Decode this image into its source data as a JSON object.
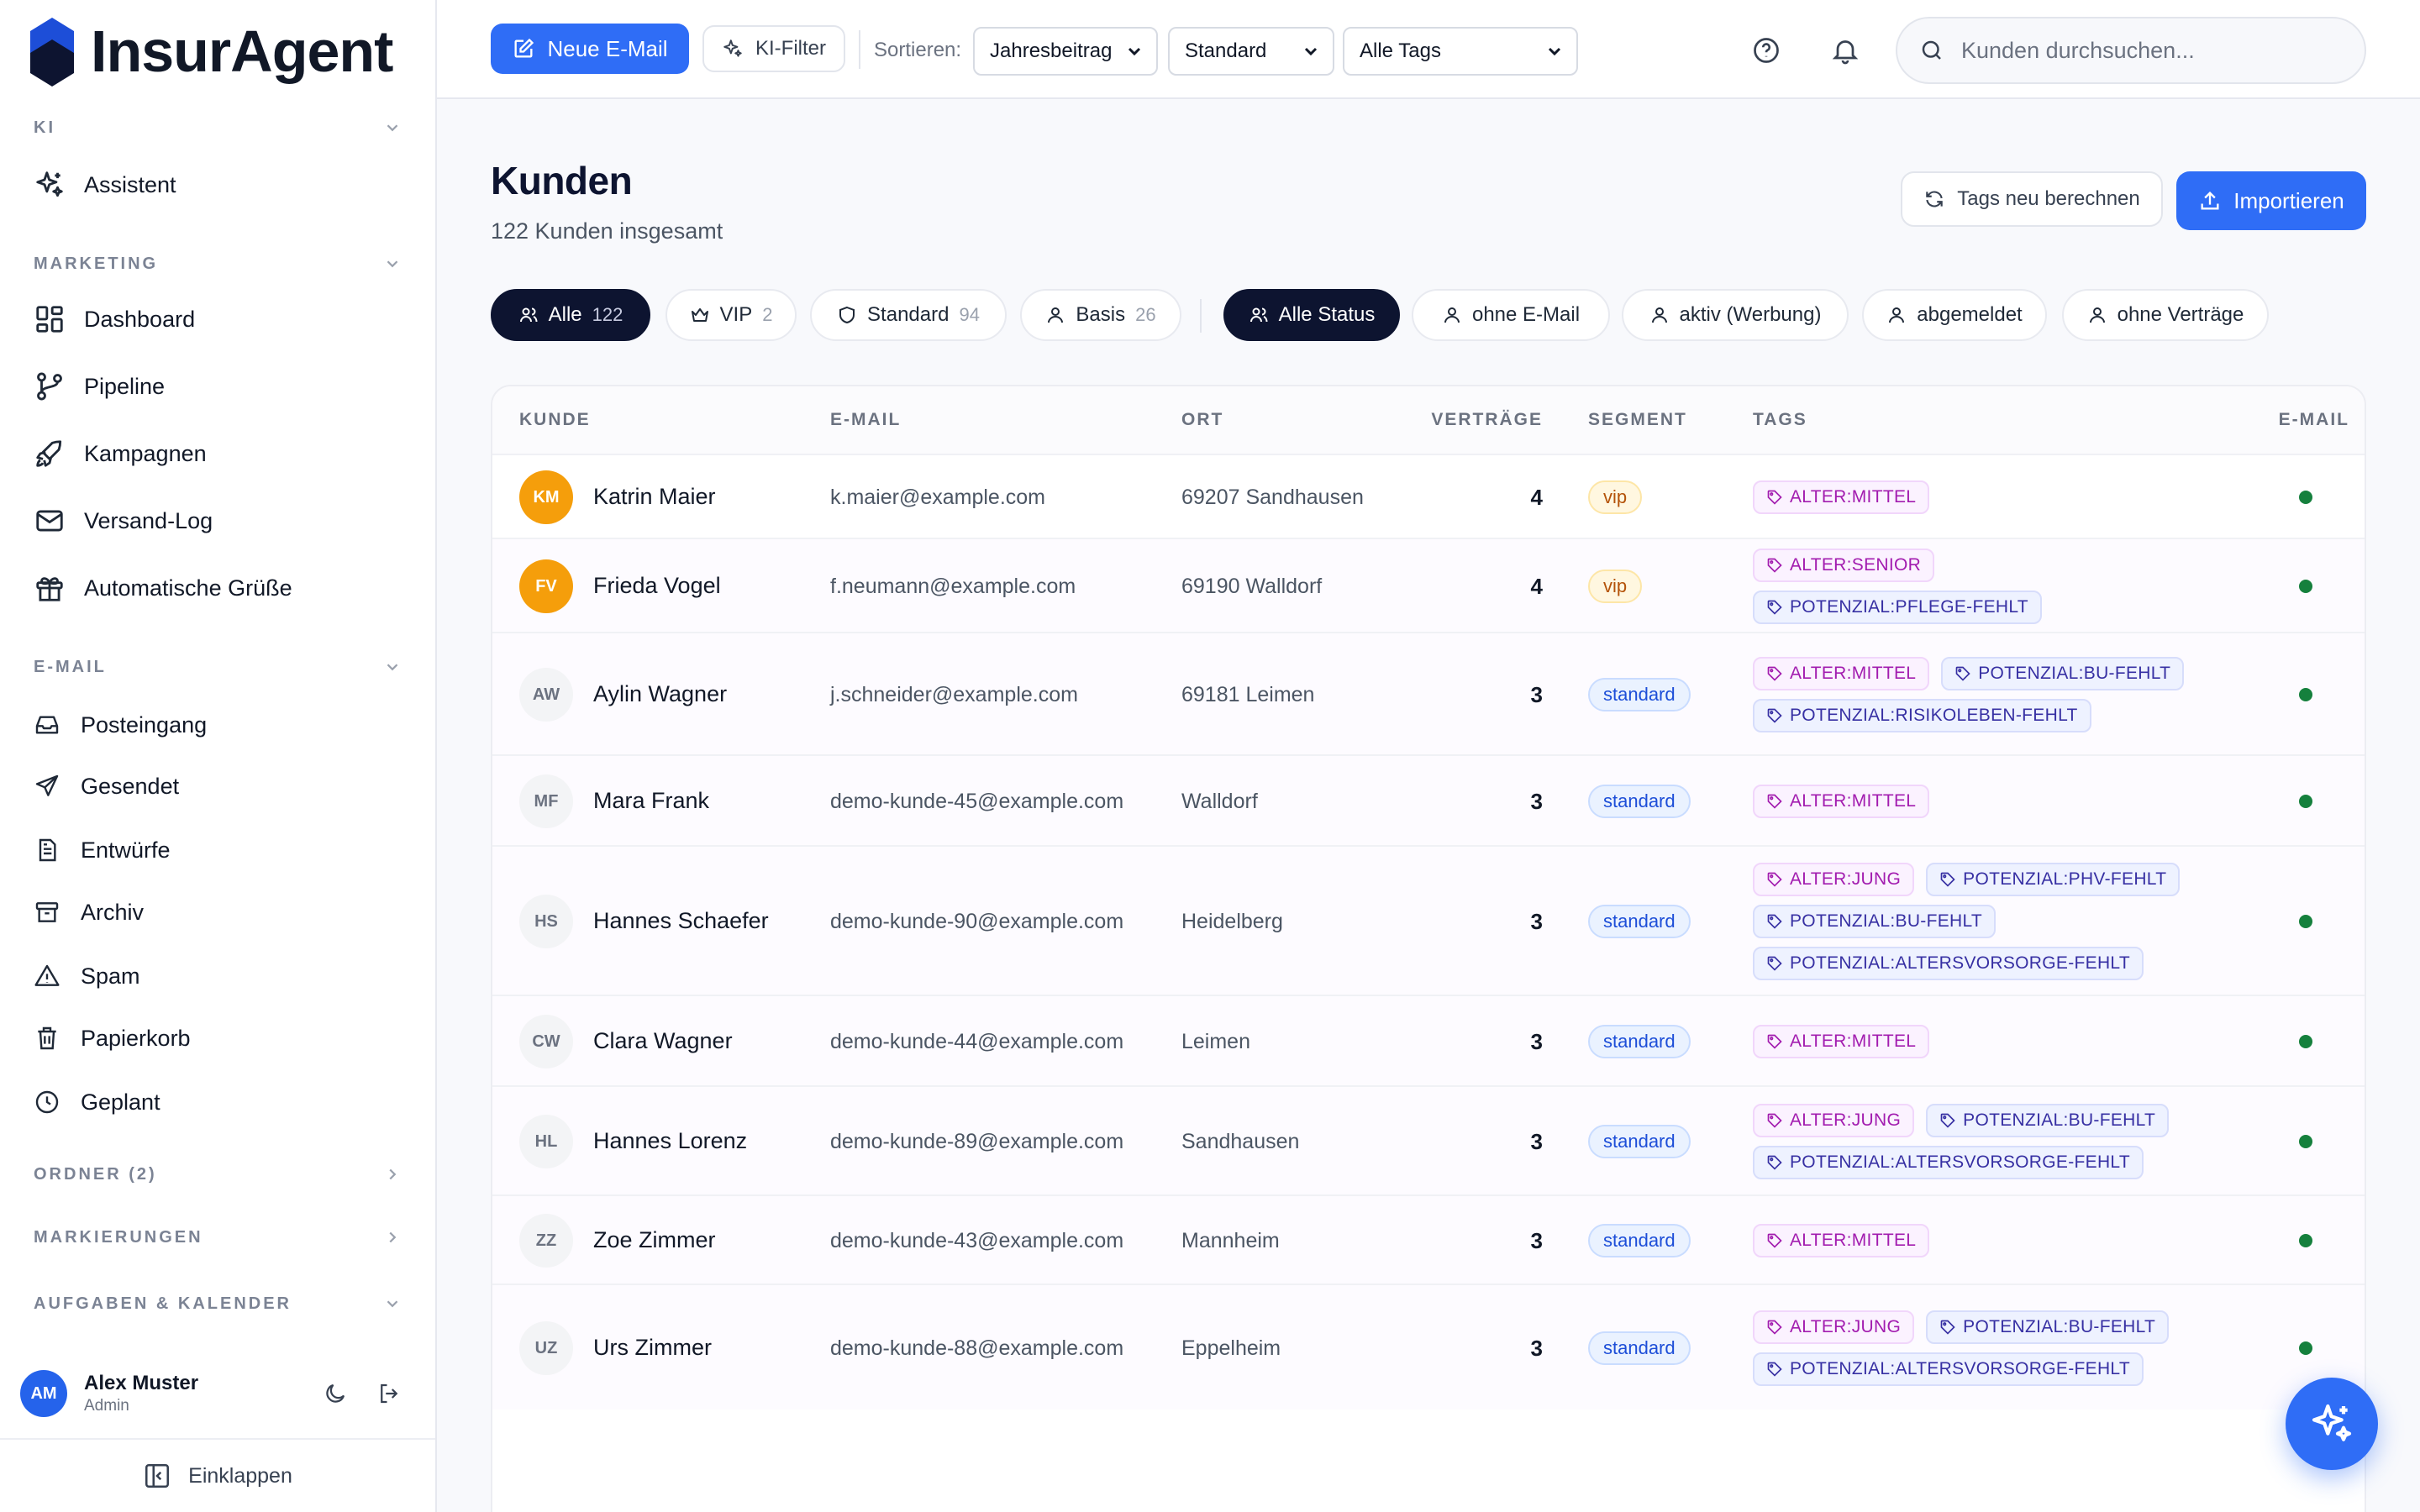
{
  "app": {
    "title": "InsurAgent"
  },
  "sidebar": {
    "sections": [
      {
        "label": "KI",
        "items": [
          {
            "label": "Assistent",
            "icon": "sparkles-icon"
          }
        ]
      },
      {
        "label": "MARKETING",
        "items": [
          {
            "label": "Dashboard",
            "icon": "dashboard-icon"
          },
          {
            "label": "Pipeline",
            "icon": "pipeline-icon"
          },
          {
            "label": "Kampagnen",
            "icon": "rocket-icon"
          },
          {
            "label": "Versand-Log",
            "icon": "mail-icon"
          },
          {
            "label": "Automatische Grüße",
            "icon": "gift-icon"
          }
        ]
      },
      {
        "label": "E-MAIL",
        "items": [
          {
            "label": "Posteingang",
            "icon": "inbox-icon"
          },
          {
            "label": "Gesendet",
            "icon": "send-icon"
          },
          {
            "label": "Entwürfe",
            "icon": "draft-icon"
          },
          {
            "label": "Archiv",
            "icon": "archive-icon"
          },
          {
            "label": "Spam",
            "icon": "warning-icon"
          },
          {
            "label": "Papierkorb",
            "icon": "trash-icon"
          },
          {
            "label": "Geplant",
            "icon": "clock-icon"
          }
        ]
      },
      {
        "label": "ORDNER (2)",
        "items": []
      },
      {
        "label": "MARKIERUNGEN",
        "items": []
      },
      {
        "label": "AUFGABEN & KALENDER",
        "items": []
      }
    ],
    "user": {
      "initials": "AM",
      "name": "Alex Muster",
      "role": "Admin"
    },
    "collapse_label": "Einklappen"
  },
  "toolbar": {
    "new_email": "Neue E-Mail",
    "ai_filter": "KI-Filter",
    "sort_label": "Sortieren:",
    "sort_value": "Jahresbeitrag",
    "segment_value": "Standard",
    "tags_value": "Alle Tags",
    "search_placeholder": "Kunden durchsuchen..."
  },
  "page": {
    "title": "Kunden",
    "subtitle": "122 Kunden insgesamt",
    "recalc_button": "Tags neu berechnen",
    "import_button": "Importieren"
  },
  "filters": {
    "segments": [
      {
        "label": "Alle",
        "count": "122",
        "active": true
      },
      {
        "label": "VIP",
        "count": "2",
        "active": false
      },
      {
        "label": "Standard",
        "count": "94",
        "active": false
      },
      {
        "label": "Basis",
        "count": "26",
        "active": false
      }
    ],
    "status": [
      {
        "label": "Alle Status",
        "active": true
      },
      {
        "label": "ohne E-Mail",
        "active": false
      },
      {
        "label": "aktiv (Werbung)",
        "active": false
      },
      {
        "label": "abgemeldet",
        "active": false
      },
      {
        "label": "ohne Verträge",
        "active": false
      }
    ]
  },
  "table": {
    "headers": {
      "kunde": "KUNDE",
      "email": "E-MAIL",
      "ort": "ORT",
      "vertraege": "VERTRÄGE",
      "segment": "SEGMENT",
      "tags": "TAGS",
      "email_status": "E-MAIL"
    },
    "rows": [
      {
        "initials": "KM",
        "name": "Katrin Maier",
        "email": "k.maier@example.com",
        "ort": "69207 Sandhausen",
        "vertraege": "4",
        "segment": "vip",
        "tags": [
          "ALTER:MITTEL"
        ]
      },
      {
        "initials": "FV",
        "name": "Frieda Vogel",
        "email": "f.neumann@example.com",
        "ort": "69190 Walldorf",
        "vertraege": "4",
        "segment": "vip",
        "tags": [
          "ALTER:SENIOR",
          "POTENZIAL:PFLEGE-FEHLT"
        ]
      },
      {
        "initials": "AW",
        "name": "Aylin Wagner",
        "email": "j.schneider@example.com",
        "ort": "69181 Leimen",
        "vertraege": "3",
        "segment": "standard",
        "tags": [
          "ALTER:MITTEL",
          "POTENZIAL:BU-FEHLT",
          "POTENZIAL:RISIKOLEBEN-FEHLT"
        ]
      },
      {
        "initials": "MF",
        "name": "Mara Frank",
        "email": "demo-kunde-45@example.com",
        "ort": "Walldorf",
        "vertraege": "3",
        "segment": "standard",
        "tags": [
          "ALTER:MITTEL"
        ]
      },
      {
        "initials": "HS",
        "name": "Hannes Schaefer",
        "email": "demo-kunde-90@example.com",
        "ort": "Heidelberg",
        "vertraege": "3",
        "segment": "standard",
        "tags": [
          "ALTER:JUNG",
          "POTENZIAL:PHV-FEHLT",
          "POTENZIAL:BU-FEHLT",
          "POTENZIAL:ALTERSVORSORGE-FEHLT"
        ]
      },
      {
        "initials": "CW",
        "name": "Clara Wagner",
        "email": "demo-kunde-44@example.com",
        "ort": "Leimen",
        "vertraege": "3",
        "segment": "standard",
        "tags": [
          "ALTER:MITTEL"
        ]
      },
      {
        "initials": "HL",
        "name": "Hannes Lorenz",
        "email": "demo-kunde-89@example.com",
        "ort": "Sandhausen",
        "vertraege": "3",
        "segment": "standard",
        "tags": [
          "ALTER:JUNG",
          "POTENZIAL:BU-FEHLT",
          "POTENZIAL:ALTERSVORSORGE-FEHLT"
        ]
      },
      {
        "initials": "ZZ",
        "name": "Zoe Zimmer",
        "email": "demo-kunde-43@example.com",
        "ort": "Mannheim",
        "vertraege": "3",
        "segment": "standard",
        "tags": [
          "ALTER:MITTEL"
        ]
      },
      {
        "initials": "UZ",
        "name": "Urs Zimmer",
        "email": "demo-kunde-88@example.com",
        "ort": "Eppelheim",
        "vertraege": "3",
        "segment": "standard",
        "tags": [
          "ALTER:JUNG",
          "POTENZIAL:BU-FEHLT",
          "POTENZIAL:ALTERSVORSORGE-FEHLT"
        ]
      }
    ]
  },
  "colors": {
    "accent": "#2f6df6",
    "dark": "#0d1430",
    "vip_avatar": "#f59e0b",
    "status_green": "#15803d"
  }
}
